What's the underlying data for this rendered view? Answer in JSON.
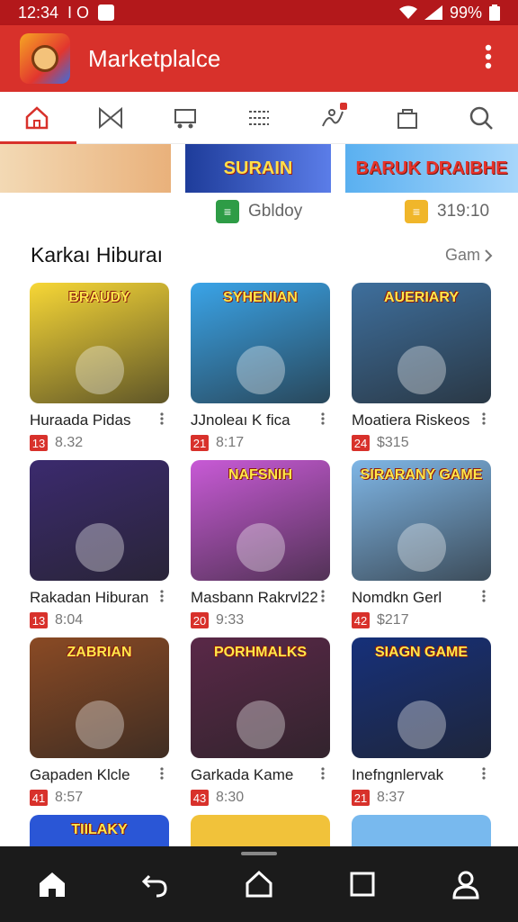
{
  "status_bar": {
    "time": "12:34",
    "left_glyph": "I O",
    "battery": "99%"
  },
  "app_bar": {
    "title": "Marketplalce"
  },
  "tabs": [
    "home-icon",
    "bowtie-icon",
    "cart-icon",
    "list-icon",
    "activity-icon",
    "bag-icon",
    "search-icon"
  ],
  "banners": [
    {
      "text": ""
    },
    {
      "text": "SURAIN"
    },
    {
      "text": "BARUK DRAIBHE"
    }
  ],
  "chips": [
    {
      "label": "Gbldoy",
      "color": "#2e9c46"
    },
    {
      "label": "319:10",
      "color": "#f0b62a"
    }
  ],
  "section": {
    "title": "Karkaı Hiburaı",
    "see_all": "Gam"
  },
  "apps": [
    {
      "thumb_title": "BRAUDY",
      "name": "Huraada Pidas",
      "badge": "13",
      "price": "8.32",
      "color": "#f7d736"
    },
    {
      "thumb_title": "SYHENIAN",
      "name": "JJnoleaı K fica",
      "badge": "21",
      "price": "8:17",
      "color": "#3aa4e8"
    },
    {
      "thumb_title": "AUERIARY",
      "name": "Moatiera Riskeos",
      "badge": "24",
      "price": "$315",
      "color": "#3e6f9d"
    },
    {
      "thumb_title": "",
      "name": "Rakadan Hiburan",
      "badge": "13",
      "price": "8:04",
      "color": "#3b2a6e"
    },
    {
      "thumb_title": "NAFSNIH",
      "name": "Masbann Rakrvl22",
      "badge": "20",
      "price": "9:33",
      "color": "#c85ad6"
    },
    {
      "thumb_title": "SIRARANY GAME",
      "name": "Nomdkn Gerl",
      "badge": "42",
      "price": "$217",
      "color": "#7fb6e6"
    },
    {
      "thumb_title": "ZABRIAN",
      "name": "Gapaden Klcle",
      "badge": "41",
      "price": "8:57",
      "color": "#8a4a24"
    },
    {
      "thumb_title": "PORHMALKS",
      "name": "Garkada Kame",
      "badge": "43",
      "price": "8:30",
      "color": "#5a2848"
    },
    {
      "thumb_title": "SIAGN GAME",
      "name": "Inefngnlervak",
      "badge": "21",
      "price": "8:37",
      "color": "#16307a"
    }
  ],
  "partial_titles": [
    "TIILAKY",
    "",
    ""
  ],
  "nav_bar": [
    "home-icon",
    "back-icon",
    "home-outline-icon",
    "square-icon",
    "person-icon"
  ]
}
